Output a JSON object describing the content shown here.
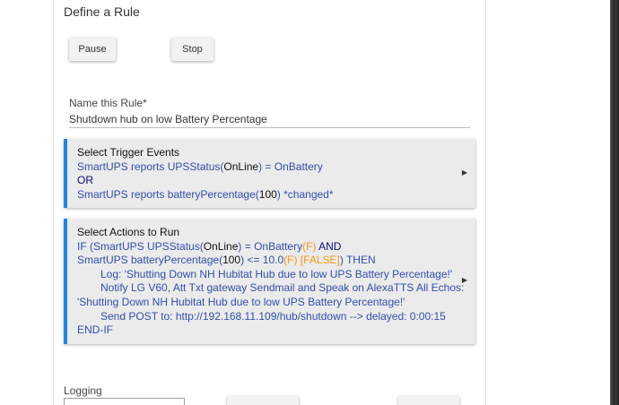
{
  "page": {
    "title": "Define a Rule"
  },
  "controls": {
    "pause_label": "Pause",
    "stop_label": "Stop"
  },
  "rule_name": {
    "label": "Name this Rule*",
    "value": "Shutdown hub on low Battery Percentage"
  },
  "trigger": {
    "title": "Select Trigger Events",
    "line1": {
      "a": "SmartUPS reports UPSStatus(",
      "b": "OnLine",
      "c": ") = OnBattery"
    },
    "line2": "OR",
    "line3": {
      "a": "SmartUPS reports batteryPercentage(",
      "b": "100",
      "c": ") *changed*"
    }
  },
  "actions": {
    "title": "Select Actions to Run",
    "line1": {
      "a": "IF (SmartUPS UPSStatus(",
      "b": "OnLine",
      "c": ") = OnBattery",
      "d": "(F)",
      "e": "  AND"
    },
    "line2": {
      "a": "SmartUPS batteryPercentage(",
      "b": "100",
      "c": ") <= 10.0",
      "d": "(F)",
      "e": " [FALSE]",
      "f": ") THEN"
    },
    "line3": "Log: 'Shutting Down NH Hubitat Hub due to low UPS Battery Percentage!'",
    "line4": "Notify LG V60, Att Txt gateway Sendmail and Speak on AlexaTTS All Echos:",
    "line5": "'Shutting Down NH Hubitat Hub due to low UPS Battery Percentage!'",
    "line6": "Send POST to: http://192.168.11.109/hub/shutdown --> delayed: 0:00:15",
    "line7": "END-IF"
  },
  "logging": {
    "label": "Logging"
  },
  "colors": {
    "accent": "#1e88e5",
    "link_text": "#2f4fad",
    "false_orange": "#f29b13",
    "card_bg": "#ebebeb"
  },
  "icons": {
    "expand": "triangle-right"
  }
}
